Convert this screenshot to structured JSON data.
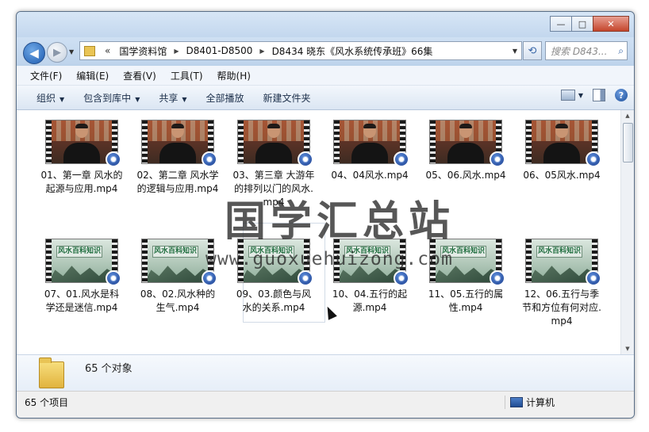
{
  "window": {
    "buttons": {
      "minimize": "—",
      "maximize": "□",
      "close": "✕"
    }
  },
  "nav": {
    "back_icon": "◀",
    "forward_icon": "▶",
    "history_dropdown": "▼",
    "path_prefix": "«",
    "breadcrumbs": [
      "国学资料馆",
      "D8401-D8500",
      "D8434 晓东《风水系统传承班》66集"
    ],
    "address_dropdown": "▼",
    "refresh_icon": "⟲",
    "search_placeholder": "搜索 D843...",
    "search_icon": "⌕"
  },
  "menu": [
    "文件(F)",
    "编辑(E)",
    "查看(V)",
    "工具(T)",
    "帮助(H)"
  ],
  "commands": [
    {
      "label": "组织",
      "dropdown": true
    },
    {
      "label": "包含到库中",
      "dropdown": true
    },
    {
      "label": "共享",
      "dropdown": true
    },
    {
      "label": "全部播放",
      "dropdown": false
    },
    {
      "label": "新建文件夹",
      "dropdown": false
    }
  ],
  "help_label": "?",
  "files": [
    {
      "name": "01、第一章 风水的起源与应用.mp4",
      "thumb": "studio"
    },
    {
      "name": "02、第二章 风水学的逻辑与应用.mp4",
      "thumb": "studio"
    },
    {
      "name": "03、第三章 大游年的排列以门的风水.mp4",
      "thumb": "studio"
    },
    {
      "name": "04、04风水.mp4",
      "thumb": "studio"
    },
    {
      "name": "05、06.风水.mp4",
      "thumb": "studio"
    },
    {
      "name": "06、05风水.mp4",
      "thumb": "studio"
    },
    {
      "name": "07、01.风水是科学还是迷信.mp4",
      "thumb": "landscape"
    },
    {
      "name": "08、02.风水种的生气.mp4",
      "thumb": "landscape"
    },
    {
      "name": "09、03.颜色与风水的关系.mp4",
      "thumb": "landscape"
    },
    {
      "name": "10、04.五行的起源.mp4",
      "thumb": "landscape"
    },
    {
      "name": "11、05.五行的属性.mp4",
      "thumb": "landscape"
    },
    {
      "name": "12、06.五行与季节和方位有何对应.mp4",
      "thumb": "landscape"
    }
  ],
  "thumbnail_banner": "风水百科知识",
  "watermark": {
    "title": "国学汇总站",
    "url": "www.guoxuehuizong.com"
  },
  "details": {
    "count": "65 个对象"
  },
  "status": {
    "items": "65 个项目",
    "location": "计算机"
  },
  "scroll": {
    "up": "▲",
    "down": "▼"
  }
}
